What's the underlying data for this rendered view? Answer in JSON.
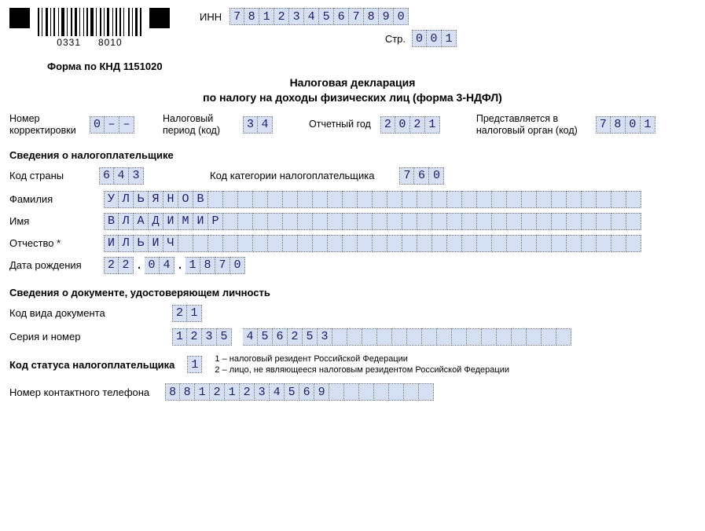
{
  "header": {
    "barcode_num_left": "0331",
    "barcode_num_right": "8010",
    "inn_label": "ИНН",
    "inn": [
      "7",
      "8",
      "1",
      "2",
      "3",
      "4",
      "5",
      "6",
      "7",
      "8",
      "9",
      "0"
    ],
    "page_label": "Стр.",
    "page": [
      "0",
      "0",
      "1"
    ]
  },
  "form_code": "Форма по КНД 1151020",
  "title_line1": "Налоговая декларация",
  "title_line2": "по налогу на доходы физических лиц (форма 3-НДФЛ)",
  "row1": {
    "corr_label": "Номер\nкорректировки",
    "corr": [
      "0",
      "–",
      "–"
    ],
    "period_label": "Налоговый\nпериод (код)",
    "period": [
      "3",
      "4"
    ],
    "year_label": "Отчетный год",
    "year": [
      "2",
      "0",
      "2",
      "1"
    ],
    "organ_label": "Представляется в\nналоговый орган (код)",
    "organ": [
      "7",
      "8",
      "0",
      "1"
    ]
  },
  "taxpayer_section": "Сведения о налогоплательщике",
  "country_label": "Код страны",
  "country": [
    "6",
    "4",
    "3"
  ],
  "category_label": "Код категории налогоплательщика",
  "category": [
    "7",
    "6",
    "0"
  ],
  "surname_label": "Фамилия",
  "surname": [
    "У",
    "Л",
    "Ь",
    "Я",
    "Н",
    "О",
    "В"
  ],
  "name_label": "Имя",
  "name": [
    "В",
    "Л",
    "А",
    "Д",
    "И",
    "М",
    "И",
    "Р"
  ],
  "patronymic_label": "Отчество *",
  "patronymic": [
    "И",
    "Л",
    "Ь",
    "И",
    "Ч"
  ],
  "dob_label": "Дата рождения",
  "dob": {
    "d": [
      "2",
      "2"
    ],
    "m": [
      "0",
      "4"
    ],
    "y": [
      "1",
      "8",
      "7",
      "0"
    ]
  },
  "doc_section": "Сведения о документе, удостоверяющем личность",
  "doc_type_label": "Код вида документа",
  "doc_type": [
    "2",
    "1"
  ],
  "doc_num_label": "Серия и номер",
  "doc_num_series": [
    "1",
    "2",
    "3",
    "5"
  ],
  "doc_num_number": [
    "4",
    "5",
    "6",
    "2",
    "5",
    "3"
  ],
  "status_label": "Код статуса налогоплательщика",
  "status": [
    "1"
  ],
  "status_hint1": "1 – налоговый резидент Российской Федерации",
  "status_hint2": "2 – лицо, не являющееся налоговым резидентом Российской Федерации",
  "phone_label": "Номер контактного телефона",
  "phone": [
    "8",
    "8",
    "1",
    "2",
    "1",
    "2",
    "3",
    "4",
    "5",
    "6",
    "9"
  ],
  "long_field_len": 36,
  "doc_num_total_len": 26,
  "phone_len": 18
}
